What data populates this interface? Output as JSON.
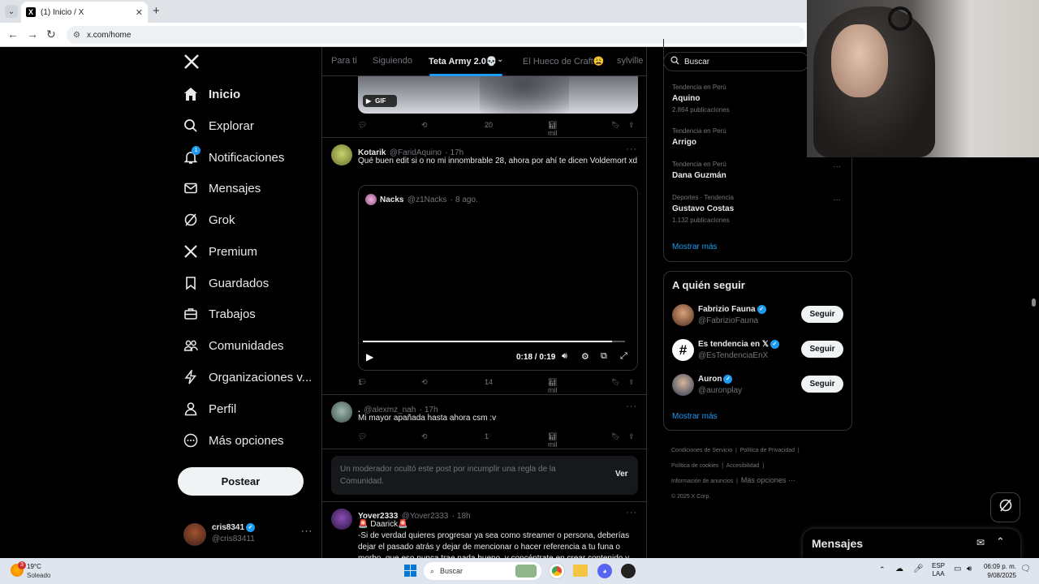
{
  "browser": {
    "tab_title": "(1) Inicio / X",
    "url": "x.com/home"
  },
  "sidebar": {
    "items": [
      {
        "label": "Inicio",
        "icon": "home-icon"
      },
      {
        "label": "Explorar",
        "icon": "search-icon"
      },
      {
        "label": "Notificaciones",
        "icon": "bell-icon",
        "badge": "1"
      },
      {
        "label": "Mensajes",
        "icon": "mail-icon"
      },
      {
        "label": "Grok",
        "icon": "grok-icon"
      },
      {
        "label": "Premium",
        "icon": "x-logo-icon"
      },
      {
        "label": "Guardados",
        "icon": "bookmark-icon"
      },
      {
        "label": "Trabajos",
        "icon": "briefcase-icon"
      },
      {
        "label": "Comunidades",
        "icon": "people-icon"
      },
      {
        "label": "Organizaciones v...",
        "icon": "lightning-icon"
      },
      {
        "label": "Perfil",
        "icon": "person-icon"
      },
      {
        "label": "Más opciones",
        "icon": "more-circle-icon"
      }
    ],
    "post_button": "Postear",
    "account": {
      "name": "cris8341",
      "handle": "@cris83411"
    }
  },
  "timeline": {
    "tabs": [
      "Para ti",
      "Siguiendo",
      "Teta Army 2.0💀",
      "El Hueco de Craft😩",
      "sylville"
    ],
    "active_tab": "Teta Army 2.0💀",
    "post0": {
      "gif_label": "GIF",
      "replies": "",
      "reposts": "",
      "likes": "20",
      "views": "1 mil"
    },
    "post1": {
      "name": "Kotarik",
      "handle": "@FaridAquino",
      "time": "· 17h",
      "text": "Qué buen edit si o no mi innombrable 28, ahora por ahí te dicen Voldemort xd",
      "quote": {
        "name": "Nacks",
        "handle": "@z1Nacks",
        "time": "· 8 ago."
      },
      "video_time": "0:18 / 0:19",
      "video_progress": 0.95,
      "replies": "1",
      "reposts": "",
      "likes": "14",
      "views": "2 mil"
    },
    "post2": {
      "name": ".",
      "handle": "@alexmz_nah",
      "time": "· 17h",
      "text": "Mi mayor apañada hasta ahora csm :v",
      "replies": "",
      "reposts": "",
      "likes": "1",
      "views": "1 mil"
    },
    "hidden": {
      "text": "Un moderador ocultó este post por incumplir una regla de la Comunidad.",
      "button": "Ver"
    },
    "post3": {
      "name": "Yover2333",
      "handle": "@Yover2333",
      "time": "· 18h",
      "line1": "🚨 Daarick🚨",
      "text": "-Si de verdad quieres progresar ya sea como streamer o persona, deberías dejar el pasado atrás y dejar de mencionar o hacer referencia a tu funa o morbo, que eso nunca trae nada bueno, y concéntrate en crear contenido y"
    }
  },
  "right": {
    "search_placeholder": "Buscar",
    "trends": [
      {
        "cat": "Tendencia en Perú",
        "name": "Aquino",
        "count": "2.864 publicaciones"
      },
      {
        "cat": "Tendencia en Perú",
        "name": "Arrigo",
        "count": ""
      },
      {
        "cat": "Tendencia en Perú",
        "name": "Dana Guzmán",
        "count": ""
      },
      {
        "cat": "Deportes · Tendencia",
        "name": "Gustavo Costas",
        "count": "1.132 publicaciones"
      }
    ],
    "show_more": "Mostrar más",
    "who_to_follow": "A quién seguir",
    "follow": [
      {
        "name": "Fabrizio Fauna",
        "handle": "@FabrizioFauna",
        "btn": "Seguir"
      },
      {
        "name": "Es tendencia en 𝕏",
        "handle": "@EsTendenciaEnX",
        "btn": "Seguir"
      },
      {
        "name": "Auron",
        "handle": "@auronplay",
        "btn": "Seguir"
      }
    ],
    "follow_more": "Mostrar más",
    "footer": {
      "l1": "Condiciones de Servicio",
      "l2": "Política de Privacidad",
      "l3": "Política de cookies",
      "l4": "Accesibilidad",
      "l5": "Información de anuncios",
      "l6": "Más opciones ···",
      "copy": "© 2025 X Corp."
    },
    "messages": "Mensajes"
  },
  "taskbar": {
    "temp": "19°C",
    "weather": "Soleado",
    "weather_badge": "3",
    "search": "Buscar",
    "lang1": "ESP",
    "lang2": "LAA",
    "time": "06:09 p. m.",
    "date": "9/08/2025"
  },
  "colors": {
    "accent": "#1d9bf0",
    "bg": "#000000",
    "border": "#2f3336",
    "muted": "#71767b"
  }
}
